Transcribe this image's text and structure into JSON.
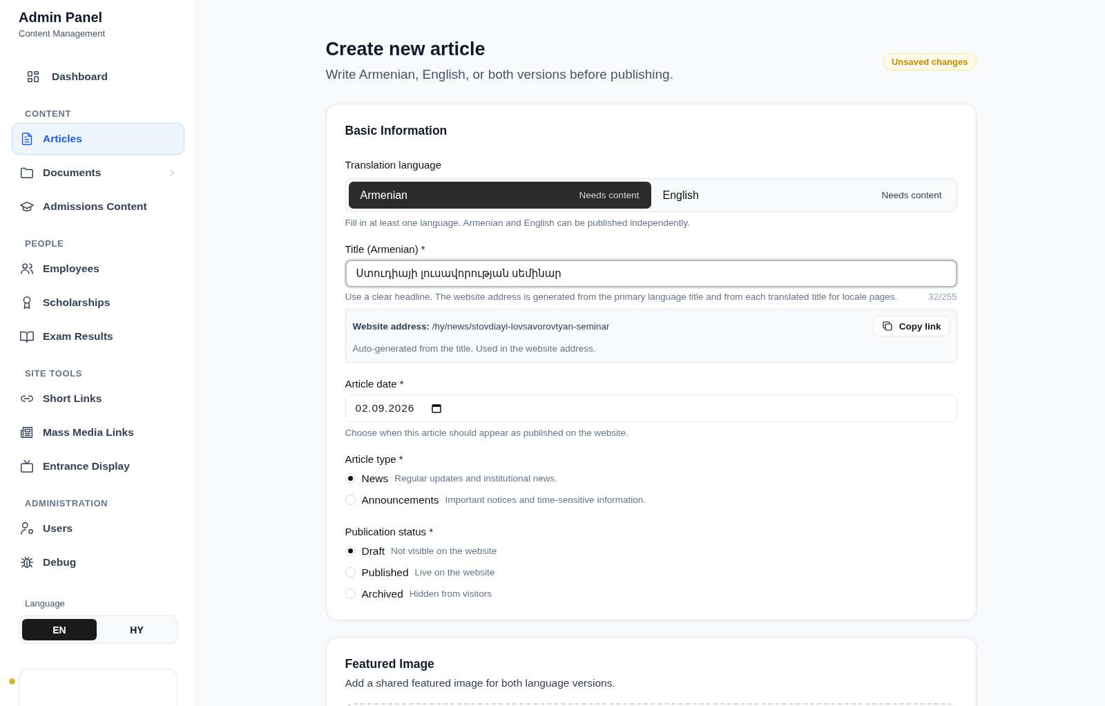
{
  "sidebar": {
    "title": "Admin Panel",
    "subtitle": "Content Management",
    "sections": [
      {
        "items": [
          {
            "label": "Dashboard",
            "selected": false,
            "has_children": false
          }
        ]
      },
      {
        "heading": "CONTENT",
        "items": [
          {
            "label": "Articles",
            "selected": true,
            "has_children": false
          },
          {
            "label": "Documents",
            "selected": false,
            "has_children": true
          },
          {
            "label": "Admissions Content",
            "selected": false,
            "has_children": false
          }
        ]
      },
      {
        "heading": "PEOPLE",
        "items": [
          {
            "label": "Employees",
            "selected": false,
            "has_children": false
          },
          {
            "label": "Scholarships",
            "selected": false,
            "has_children": false
          },
          {
            "label": "Exam Results",
            "selected": false,
            "has_children": false
          }
        ]
      },
      {
        "heading": "SITE TOOLS",
        "items": [
          {
            "label": "Short Links",
            "selected": false,
            "has_children": false
          },
          {
            "label": "Mass Media Links",
            "selected": false,
            "has_children": false
          },
          {
            "label": "Entrance Display",
            "selected": false,
            "has_children": false
          }
        ]
      },
      {
        "heading": "ADMINISTRATION",
        "items": [
          {
            "label": "Users",
            "selected": false,
            "has_children": false
          },
          {
            "label": "Debug",
            "selected": false,
            "has_children": false
          }
        ]
      }
    ],
    "language": {
      "label": "Language",
      "options": [
        {
          "label": "EN",
          "selected": true
        },
        {
          "label": "HY",
          "selected": false
        }
      ]
    }
  },
  "header": {
    "title": "Create new article",
    "subtitle": "Write Armenian, English, or both versions before publishing.",
    "badge": "Unsaved changes"
  },
  "basic_information": {
    "heading": "Basic Information",
    "translation": {
      "label": "Translation language",
      "options": [
        {
          "label": "Armenian",
          "status": "Needs content",
          "selected": true
        },
        {
          "label": "English",
          "status": "Needs content",
          "selected": false
        }
      ],
      "hint": "Fill in at least one language. Armenian and English can be published independently."
    },
    "title_field": {
      "label": "Title (Armenian) *",
      "value": "Ստուդիայի լուսավորության սեմինար",
      "hint": "Use a clear headline. The website address is generated from the primary language title and from each translated title for locale pages.",
      "counter": "32/255"
    },
    "website_address": {
      "label": "Website address:",
      "value": "/hy/news/stovdiayi-lovsavorovtyan-seminar",
      "button": "Copy link",
      "note": "Auto-generated from the title. Used in the website address."
    },
    "date_field": {
      "label": "Article date *",
      "value": "02.09.2026",
      "hint": "Choose when this article should appear as published on the website."
    },
    "article_type": {
      "label": "Article type *",
      "options": [
        {
          "label": "News",
          "description": "Regular updates and institutional news.",
          "selected": true
        },
        {
          "label": "Announcements",
          "description": "Important notices and time-sensitive information.",
          "selected": false
        }
      ]
    },
    "publication_status": {
      "label": "Publication status *",
      "options": [
        {
          "label": "Draft",
          "description": "Not visible on the website",
          "selected": true
        },
        {
          "label": "Published",
          "description": "Live on the website",
          "selected": false
        },
        {
          "label": "Archived",
          "description": "Hidden from visitors",
          "selected": false
        }
      ]
    }
  },
  "featured_image": {
    "heading": "Featured Image",
    "description": "Add a shared featured image for both language versions."
  }
}
